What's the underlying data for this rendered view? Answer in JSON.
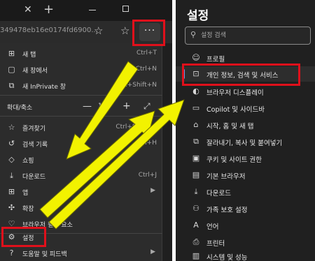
{
  "browser": {
    "tab_close": "✕",
    "tab_new": "+",
    "url_text": "349478eb16e0174fd6900...",
    "more_label": "···"
  },
  "menu": {
    "items": [
      {
        "icon": "new-tab-icon",
        "glyph": "⊞",
        "label": "새 탭",
        "shortcut": "Ctrl+T"
      },
      {
        "icon": "new-window-icon",
        "glyph": "▢",
        "label": "새 창에서",
        "shortcut": "Ctrl+N"
      },
      {
        "icon": "inprivate-icon",
        "glyph": "⧉",
        "label": "새 InPrivate 창",
        "shortcut": "Ctrl+Shift+N"
      },
      {
        "icon": "favorites-icon",
        "glyph": "☆",
        "label": "즐겨찾기",
        "shortcut": "Ctrl+Shift+O"
      },
      {
        "icon": "history-icon",
        "glyph": "↺",
        "label": "검색 기록",
        "shortcut": "Ctrl+H"
      },
      {
        "icon": "shopping-icon",
        "glyph": "◇",
        "label": "쇼핑",
        "shortcut": ""
      },
      {
        "icon": "download-icon",
        "glyph": "⤓",
        "label": "다운로드",
        "shortcut": "Ctrl+J"
      },
      {
        "icon": "apps-icon",
        "glyph": "⊞",
        "label": "앱",
        "shortcut": "",
        "arrow": "▶"
      },
      {
        "icon": "extensions-icon",
        "glyph": "✣",
        "label": "확장",
        "shortcut": ""
      },
      {
        "icon": "browser-essentials-icon",
        "glyph": "♡",
        "label": "브라우저 필수 요소",
        "shortcut": ""
      },
      {
        "icon": "settings-icon",
        "glyph": "⚙",
        "label": "설정",
        "shortcut": ""
      },
      {
        "icon": "help-icon",
        "glyph": "?",
        "label": "도움말 및 피드백",
        "shortcut": "",
        "arrow": "▶"
      }
    ],
    "zoom": {
      "label": "확대/축소",
      "minus": "—",
      "value": "100",
      "plus": "+",
      "fullscreen": "⤢"
    }
  },
  "settings": {
    "title": "설정",
    "search_placeholder": "설정 검색",
    "items": [
      {
        "icon": "profile-icon",
        "glyph": "☺",
        "label": "프로필"
      },
      {
        "icon": "lock-icon",
        "glyph": "⊡",
        "label": "개인 정보, 검색 및 서비스"
      },
      {
        "icon": "appearance-icon",
        "glyph": "◐",
        "label": "브라우저 디스플레이"
      },
      {
        "icon": "copilot-icon",
        "glyph": "▭",
        "label": "Copilot 및 사이드바"
      },
      {
        "icon": "home-icon",
        "glyph": "⌂",
        "label": "시작, 홈 및 새 탭"
      },
      {
        "icon": "share-icon",
        "glyph": "⧉",
        "label": "잘라내기, 복사 및 붙여넣기"
      },
      {
        "icon": "cookies-icon",
        "glyph": "▣",
        "label": "쿠키 및 사이트 권한"
      },
      {
        "icon": "default-browser-icon",
        "glyph": "▤",
        "label": "기본 브라우저"
      },
      {
        "icon": "download-icon",
        "glyph": "⤓",
        "label": "다운로드"
      },
      {
        "icon": "family-icon",
        "glyph": "⚇",
        "label": "가족 보호 설정"
      },
      {
        "icon": "language-icon",
        "glyph": "A",
        "label": "언어"
      },
      {
        "icon": "printer-icon",
        "glyph": "⎙",
        "label": "프린터"
      },
      {
        "icon": "system-icon",
        "glyph": "▥",
        "label": "시스템 및 성능"
      }
    ]
  },
  "colors": {
    "highlight": "#e0101b",
    "arrow": "#f2f200",
    "accent": "#5aa0e6"
  }
}
